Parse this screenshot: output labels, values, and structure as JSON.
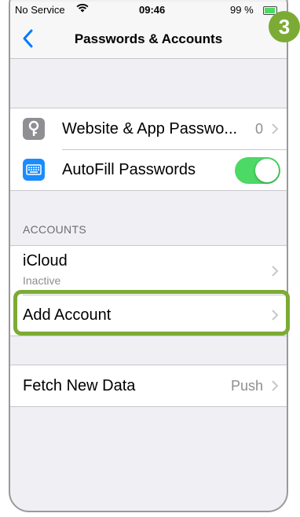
{
  "status_bar": {
    "carrier": "No Service",
    "time": "09:46",
    "battery": "99 %"
  },
  "nav": {
    "title": "Passwords & Accounts"
  },
  "group1": {
    "items": [
      {
        "label": "Website & App Passwo...",
        "value": "0"
      },
      {
        "label": "AutoFill Passwords",
        "toggle_on": true
      }
    ]
  },
  "accounts_section": {
    "header": "ACCOUNTS",
    "icloud": {
      "label": "iCloud",
      "subtitle": "Inactive"
    },
    "add_account": {
      "label": "Add Account"
    }
  },
  "fetch": {
    "label": "Fetch New Data",
    "value": "Push"
  },
  "step_badge": "3",
  "colors": {
    "highlight": "#7bab34",
    "toggle_on": "#4cd964",
    "back_blue": "#007aff"
  }
}
